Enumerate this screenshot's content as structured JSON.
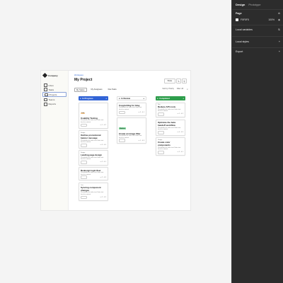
{
  "panel": {
    "tabs": [
      "Design",
      "Prototype"
    ],
    "page": {
      "label": "Page",
      "color": "F5F5F5",
      "opacity": "100%"
    },
    "sections": [
      {
        "label": "Local variables"
      },
      {
        "label": "Local styles"
      },
      {
        "label": "Export"
      }
    ]
  },
  "app": {
    "company": "Company",
    "nav": [
      "Inbox",
      "Tasks",
      "Projects",
      "Teams",
      "Reports"
    ],
    "workspace": "Workspace",
    "title": "My Project",
    "share": "Share",
    "tabs": [
      "My Status",
      "My Assignees",
      "Due Tasks"
    ],
    "filters": [
      "Sort by: Priority",
      "Filter: All"
    ],
    "columns": [
      {
        "name": "In Progress",
        "head_bg": "#3264d6",
        "head_color": "#ffffff",
        "cards": [
          {
            "badge": "Low",
            "badge_bg": "#f6c88f",
            "title": "Usability Testing",
            "desc": "Placeholder for tasks text. Enter text here for content.",
            "meta": [
              "1",
              "2"
            ]
          },
          {
            "tag": "Design",
            "title": "Outline promotional banner message",
            "desc": "Placeholder for tasks text. Enter text here for content.",
            "meta": [
              "3",
              "4"
            ]
          },
          {
            "tag": "Design",
            "title": "Landing page design",
            "desc": "Placeholder for tasks text. Enter text here for content.",
            "meta": [
              "2",
              "1"
            ]
          },
          {
            "tag": "",
            "title": "Redesign login flow",
            "desc": "Placeholder for tasks text. Enter text here for content.",
            "meta": [
              "2",
              "3"
            ]
          },
          {
            "tag": "Low",
            "title": "Syncing component changes",
            "desc": "Placeholder for tasks text. Enter text here for content.",
            "meta": [
              "2",
              "5"
            ]
          }
        ]
      },
      {
        "name": "In Review",
        "head_bg": "#ffffff",
        "head_color": "#222222",
        "cards": [
          {
            "tag": "",
            "title": "Copywriting for blog",
            "desc": "Placeholder for tasks text. Enter text here for content.",
            "meta": [
              "2",
              "1"
            ]
          },
          {
            "badge": "Medium",
            "badge_bg": "#7fd39a",
            "title": "Create an image filter",
            "desc": "Placeholder for tasks text. Enter text here for content.",
            "meta": [
              "1",
              "3"
            ]
          }
        ]
      },
      {
        "name": "Completed",
        "head_bg": "#2e9e4c",
        "head_color": "#ffffff",
        "cards": [
          {
            "tag": "Dev",
            "title": "Reduce API costs",
            "desc": "Placeholder for tasks text. Enter text here for content.",
            "meta": [
              "1",
              "2"
            ]
          },
          {
            "tag": "",
            "title": "Optimize the beta handoff workflow",
            "desc": "Placeholder for tasks text. Enter text here for content.",
            "meta": [
              "4",
              "3"
            ]
          },
          {
            "tag": "Design",
            "title": "Create color components",
            "desc": "Placeholder for tasks text. Enter text here for content.",
            "meta": [
              "2",
              "1"
            ]
          }
        ]
      }
    ]
  }
}
